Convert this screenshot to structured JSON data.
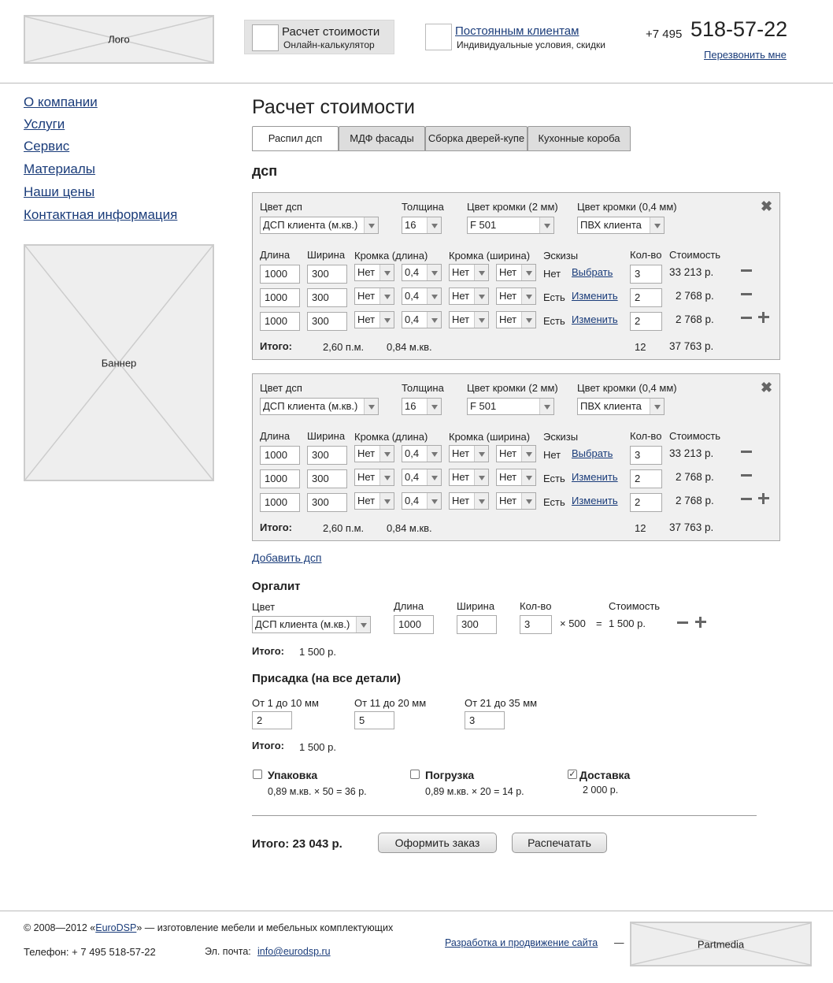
{
  "header": {
    "logo": "Лого",
    "calc_title": "Расчет стоимости",
    "calc_sub": "Онлайн-калькулятор",
    "clients_link": "Постоянным клиентам",
    "clients_sub": "Индивидуальные условия, скидки",
    "phone_prefix": "+7 495",
    "phone_main": "518-57-22",
    "callback": "Перезвонить мне"
  },
  "nav": [
    "О компании",
    "Услуги",
    "Сервис",
    "Материалы",
    "Наши цены",
    "Контактная информация"
  ],
  "banner": "Баннер",
  "page_title": "Расчет стоимости",
  "tabs": [
    "Распил дсп",
    "МДФ фасады",
    "Сборка дверей-купе",
    "Кухонные короба"
  ],
  "section_dsp": "дсп",
  "panel_labels": {
    "color": "Цвет дсп",
    "thickness": "Толщина",
    "edge2": "Цвет кромки (2 мм)",
    "edge04": "Цвет кромки (0,4 мм)",
    "length": "Длина",
    "width": "Ширина",
    "edge_len": "Кромка (длина)",
    "edge_wid": "Кромка (ширина)",
    "sketch": "Эскизы",
    "qty": "Кол-во",
    "cost": "Стоимость",
    "total": "Итого:"
  },
  "panels": [
    {
      "color": "ДСП клиента (м.кв.)",
      "thickness": "16",
      "edge2": "F 501",
      "edge04": "ПВХ клиента",
      "rows": [
        {
          "len": "1000",
          "wid": "300",
          "e1": "Нет",
          "e2": "0,4",
          "e3": "Нет",
          "e4": "Нет",
          "sketch": "Нет",
          "link": "Выбрать",
          "qty": "3",
          "cost": "33 213 р."
        },
        {
          "len": "1000",
          "wid": "300",
          "e1": "Нет",
          "e2": "0,4",
          "e3": "Нет",
          "e4": "Нет",
          "sketch": "Есть",
          "link": "Изменить",
          "qty": "2",
          "cost": "2 768 р."
        },
        {
          "len": "1000",
          "wid": "300",
          "e1": "Нет",
          "e2": "0,4",
          "e3": "Нет",
          "e4": "Нет",
          "sketch": "Есть",
          "link": "Изменить",
          "qty": "2",
          "cost": "2 768 р."
        }
      ],
      "total_pm": "2,60 п.м.",
      "total_m2": "0,84 м.кв.",
      "total_qty": "12",
      "total_cost": "37 763 р."
    },
    {
      "color": "ДСП клиента (м.кв.)",
      "thickness": "16",
      "edge2": "F 501",
      "edge04": "ПВХ клиента",
      "rows": [
        {
          "len": "1000",
          "wid": "300",
          "e1": "Нет",
          "e2": "0,4",
          "e3": "Нет",
          "e4": "Нет",
          "sketch": "Нет",
          "link": "Выбрать",
          "qty": "3",
          "cost": "33 213 р."
        },
        {
          "len": "1000",
          "wid": "300",
          "e1": "Нет",
          "e2": "0,4",
          "e3": "Нет",
          "e4": "Нет",
          "sketch": "Есть",
          "link": "Изменить",
          "qty": "2",
          "cost": "2 768 р."
        },
        {
          "len": "1000",
          "wid": "300",
          "e1": "Нет",
          "e2": "0,4",
          "e3": "Нет",
          "e4": "Нет",
          "sketch": "Есть",
          "link": "Изменить",
          "qty": "2",
          "cost": "2 768 р."
        }
      ],
      "total_pm": "2,60 п.м.",
      "total_m2": "0,84 м.кв.",
      "total_qty": "12",
      "total_cost": "37 763 р."
    }
  ],
  "add_dsp": "Добавить дсп",
  "orgalit": {
    "title": "Оргалит",
    "color_label": "Цвет",
    "len_label": "Длина",
    "wid_label": "Ширина",
    "qty_label": "Кол-во",
    "cost_label": "Стоимость",
    "color": "ДСП клиента (м.кв.)",
    "len": "1000",
    "wid": "300",
    "qty": "3",
    "mult": "× 500",
    "eq": "=",
    "cost": "1 500 р.",
    "total_label": "Итого:",
    "total": "1 500 р."
  },
  "prisadka": {
    "title": "Присадка (на все детали)",
    "l1": "От 1 до 10 мм",
    "l2": "От 11 до 20 мм",
    "l3": "От 21 до 35 мм",
    "v1": "2",
    "v2": "5",
    "v3": "3",
    "total_label": "Итого:",
    "total": "1 500 р."
  },
  "options": {
    "pack": "Упаковка",
    "pack_calc": "0,89 м.кв. × 50  =  36 р.",
    "load": "Погрузка",
    "load_calc": "0,89 м.кв. × 20  =  14 р.",
    "deliv": "Доставка",
    "deliv_cost": "2 000 р."
  },
  "grand_total": "Итого: 23 043 р.",
  "btn_order": "Оформить заказ",
  "btn_print": "Распечатать",
  "footer": {
    "copy_pre": "© 2008—2012 «",
    "copy_link": "EuroDSP",
    "copy_post": "» — изготовление мебели и мебельных комплектующих",
    "phone": "Телефон: + 7 495 518-57-22",
    "email_label": "Эл. почта:",
    "email": "info@eurodsp.ru",
    "dev_link": "Разработка и продвижение сайта",
    "dash": "—",
    "partner": "Partmedia"
  }
}
